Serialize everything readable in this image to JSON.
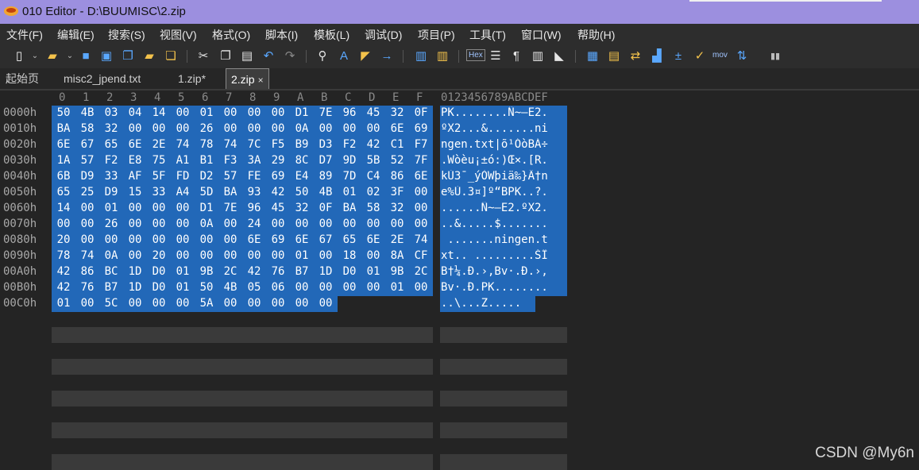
{
  "window": {
    "title": "010 Editor - D:\\BUUMISC\\2.zip"
  },
  "menu": [
    "文件(F)",
    "编辑(E)",
    "搜索(S)",
    "视图(V)",
    "格式(O)",
    "脚本(I)",
    "模板(L)",
    "调试(D)",
    "项目(P)",
    "工具(T)",
    "窗口(W)",
    "帮助(H)"
  ],
  "toolbar": {
    "hex_label": "Hex",
    "mov_label": "mov"
  },
  "tabs": [
    {
      "label": "起始页",
      "active": false
    },
    {
      "label": "misc2_jpend.txt",
      "active": false
    },
    {
      "label": "1.zip*",
      "active": false
    },
    {
      "label": "2.zip",
      "active": true,
      "close": "×"
    }
  ],
  "hex": {
    "column_headers": [
      "0",
      "1",
      "2",
      "3",
      "4",
      "5",
      "6",
      "7",
      "8",
      "9",
      "A",
      "B",
      "C",
      "D",
      "E",
      "F"
    ],
    "ascii_header": "0123456789ABCDEF",
    "rows": [
      {
        "addr": "0000h",
        "bytes": [
          "50",
          "4B",
          "03",
          "04",
          "14",
          "00",
          "01",
          "00",
          "00",
          "00",
          "D1",
          "7E",
          "96",
          "45",
          "32",
          "0F"
        ],
        "ascii": "PK........Ñ~–E2."
      },
      {
        "addr": "0010h",
        "bytes": [
          "BA",
          "58",
          "32",
          "00",
          "00",
          "00",
          "26",
          "00",
          "00",
          "00",
          "0A",
          "00",
          "00",
          "00",
          "6E",
          "69"
        ],
        "ascii": "ºX2...&.......ni"
      },
      {
        "addr": "0020h",
        "bytes": [
          "6E",
          "67",
          "65",
          "6E",
          "2E",
          "74",
          "78",
          "74",
          "7C",
          "F5",
          "B9",
          "D3",
          "F2",
          "42",
          "C1",
          "F7"
        ],
        "ascii": "ngen.txt|õ¹ÓòBÁ÷"
      },
      {
        "addr": "0030h",
        "bytes": [
          "1A",
          "57",
          "F2",
          "E8",
          "75",
          "A1",
          "B1",
          "F3",
          "3A",
          "29",
          "8C",
          "D7",
          "9D",
          "5B",
          "52",
          "7F"
        ],
        "ascii": ".Wòèu¡±ó:)Œ×.[R."
      },
      {
        "addr": "0040h",
        "bytes": [
          "6B",
          "D9",
          "33",
          "AF",
          "5F",
          "FD",
          "D2",
          "57",
          "FE",
          "69",
          "E4",
          "89",
          "7D",
          "C4",
          "86",
          "6E"
        ],
        "ascii": "kÙ3¯_ýÒWþiä‰}Ä†n"
      },
      {
        "addr": "0050h",
        "bytes": [
          "65",
          "25",
          "D9",
          "15",
          "33",
          "A4",
          "5D",
          "BA",
          "93",
          "42",
          "50",
          "4B",
          "01",
          "02",
          "3F",
          "00"
        ],
        "ascii": "e%Ù.3¤]º“BPK..?."
      },
      {
        "addr": "0060h",
        "bytes": [
          "14",
          "00",
          "01",
          "00",
          "00",
          "00",
          "D1",
          "7E",
          "96",
          "45",
          "32",
          "0F",
          "BA",
          "58",
          "32",
          "00"
        ],
        "ascii": "......Ñ~–E2.ºX2."
      },
      {
        "addr": "0070h",
        "bytes": [
          "00",
          "00",
          "26",
          "00",
          "00",
          "00",
          "0A",
          "00",
          "24",
          "00",
          "00",
          "00",
          "00",
          "00",
          "00",
          "00"
        ],
        "ascii": "..&.....$......."
      },
      {
        "addr": "0080h",
        "bytes": [
          "20",
          "00",
          "00",
          "00",
          "00",
          "00",
          "00",
          "00",
          "6E",
          "69",
          "6E",
          "67",
          "65",
          "6E",
          "2E",
          "74"
        ],
        "ascii": " .......ningen.t"
      },
      {
        "addr": "0090h",
        "bytes": [
          "78",
          "74",
          "0A",
          "00",
          "20",
          "00",
          "00",
          "00",
          "00",
          "00",
          "01",
          "00",
          "18",
          "00",
          "8A",
          "CF"
        ],
        "ascii": "xt.. .........ŠÏ"
      },
      {
        "addr": "00A0h",
        "bytes": [
          "42",
          "86",
          "BC",
          "1D",
          "D0",
          "01",
          "9B",
          "2C",
          "42",
          "76",
          "B7",
          "1D",
          "D0",
          "01",
          "9B",
          "2C"
        ],
        "ascii": "B†¼.Ð.›,Bv·.Ð.›,"
      },
      {
        "addr": "00B0h",
        "bytes": [
          "42",
          "76",
          "B7",
          "1D",
          "D0",
          "01",
          "50",
          "4B",
          "05",
          "06",
          "00",
          "00",
          "00",
          "00",
          "01",
          "00"
        ],
        "ascii": "Bv·.Ð.PK........"
      },
      {
        "addr": "00C0h",
        "bytes": [
          "01",
          "00",
          "5C",
          "00",
          "00",
          "00",
          "5A",
          "00",
          "00",
          "00",
          "00",
          "00"
        ],
        "ascii": "..\\...Z....."
      }
    ]
  },
  "watermark": "CSDN @My6n"
}
